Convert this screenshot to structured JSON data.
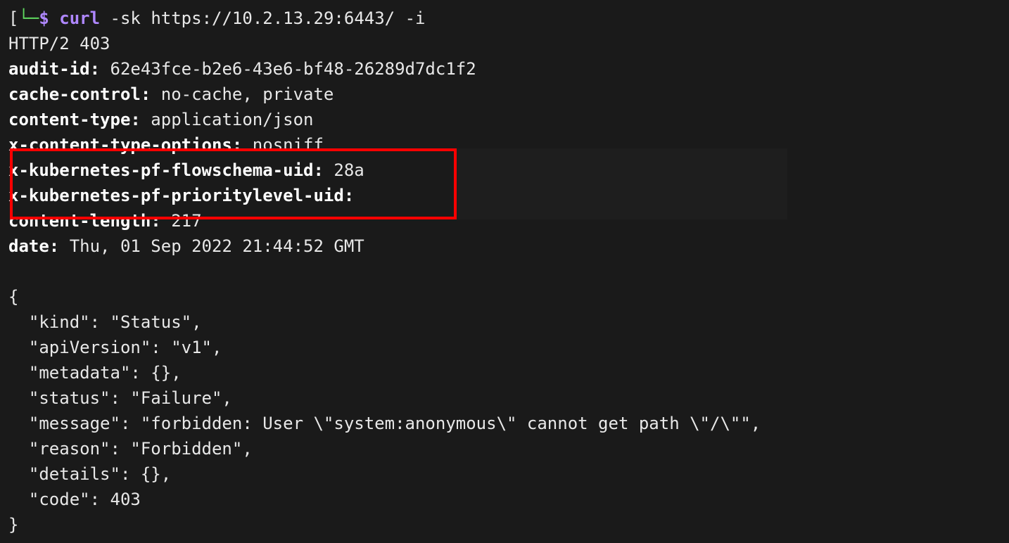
{
  "prompt": {
    "bracket": "[",
    "arrow": "└─",
    "dollar": "$",
    "command": "curl",
    "flags": "-sk",
    "url": "https://10.2.13.29:6443/",
    "flag2": "-i"
  },
  "response": {
    "status_line": "HTTP/2 403",
    "headers": [
      {
        "name": "audit-id:",
        "value": " 62e43fce-b2e6-43e6-bf48-26289d7dc1f2"
      },
      {
        "name": "cache-control:",
        "value": " no-cache, private"
      },
      {
        "name": "content-type:",
        "value": " application/json"
      },
      {
        "name": "x-content-type-options:",
        "value": " nosniff"
      },
      {
        "name": "x-kubernetes-pf-flowschema-uid:",
        "value": " 28a"
      },
      {
        "name": "x-kubernetes-pf-prioritylevel-uid:",
        "value": ""
      },
      {
        "name": "content-length:",
        "value": " 217"
      },
      {
        "name": "date:",
        "value": " Thu, 01 Sep 2022 21:44:52 GMT"
      }
    ],
    "body": "{\n  \"kind\": \"Status\",\n  \"apiVersion\": \"v1\",\n  \"metadata\": {},\n  \"status\": \"Failure\",\n  \"message\": \"forbidden: User \\\"system:anonymous\\\" cannot get path \\\"/\\\"\",\n  \"reason\": \"Forbidden\",\n  \"details\": {},\n  \"code\": 403\n}"
  }
}
